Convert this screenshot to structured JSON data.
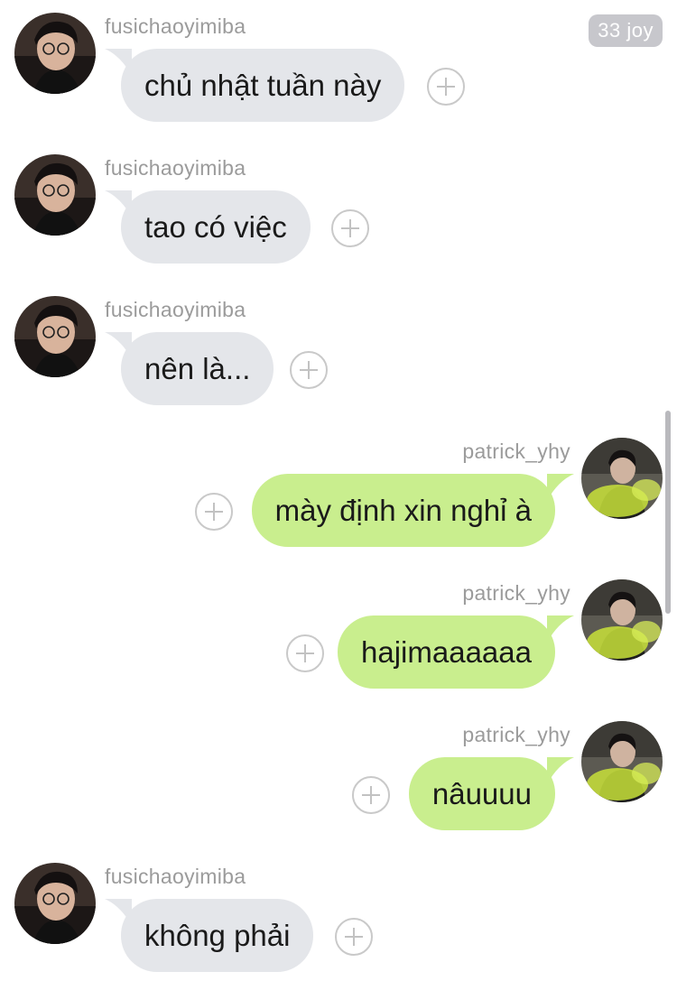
{
  "badge": {
    "label": "33 joy"
  },
  "users": {
    "left": {
      "name": "fusichaoyimiba"
    },
    "right": {
      "name": "patrick_yhy"
    }
  },
  "messages": [
    {
      "side": "left",
      "text": "chủ nhật tuần này"
    },
    {
      "side": "left",
      "text": "tao có việc"
    },
    {
      "side": "left",
      "text": "nên là..."
    },
    {
      "side": "right",
      "text": "mày định xin nghỉ à"
    },
    {
      "side": "right",
      "text": "hajimaaaaaa"
    },
    {
      "side": "right",
      "text": "nâuuuu"
    },
    {
      "side": "left",
      "text": "không phải"
    }
  ],
  "colors": {
    "left_bubble": "#e4e6ea",
    "right_bubble": "#c9ee8e",
    "sender_text": "#9b9b9b",
    "badge_bg": "#c7c7cc"
  }
}
